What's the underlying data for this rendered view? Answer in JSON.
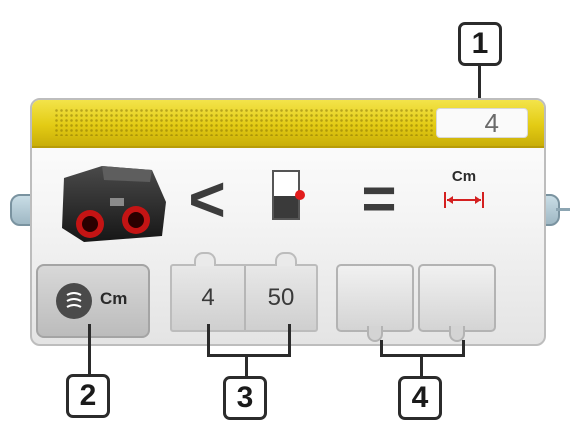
{
  "block": {
    "type": "Ultrasonic Sensor Compare Block",
    "port_value": "4",
    "comparison_symbol": "<",
    "equals_symbol": "=",
    "unit_label": "Cm",
    "mode": {
      "unit": "Cm",
      "icon": "ultrasonic-wave-icon"
    },
    "inputs": [
      {
        "value": "4"
      },
      {
        "value": "50"
      }
    ],
    "outputs_count": 2,
    "colors": {
      "header": "#e3cb14",
      "block_body": "#f0f0f0",
      "accent_red": "#e21c1c",
      "wire": "#9fb8c4"
    }
  },
  "callouts": [
    {
      "number": "1"
    },
    {
      "number": "2"
    },
    {
      "number": "3"
    },
    {
      "number": "4"
    }
  ]
}
